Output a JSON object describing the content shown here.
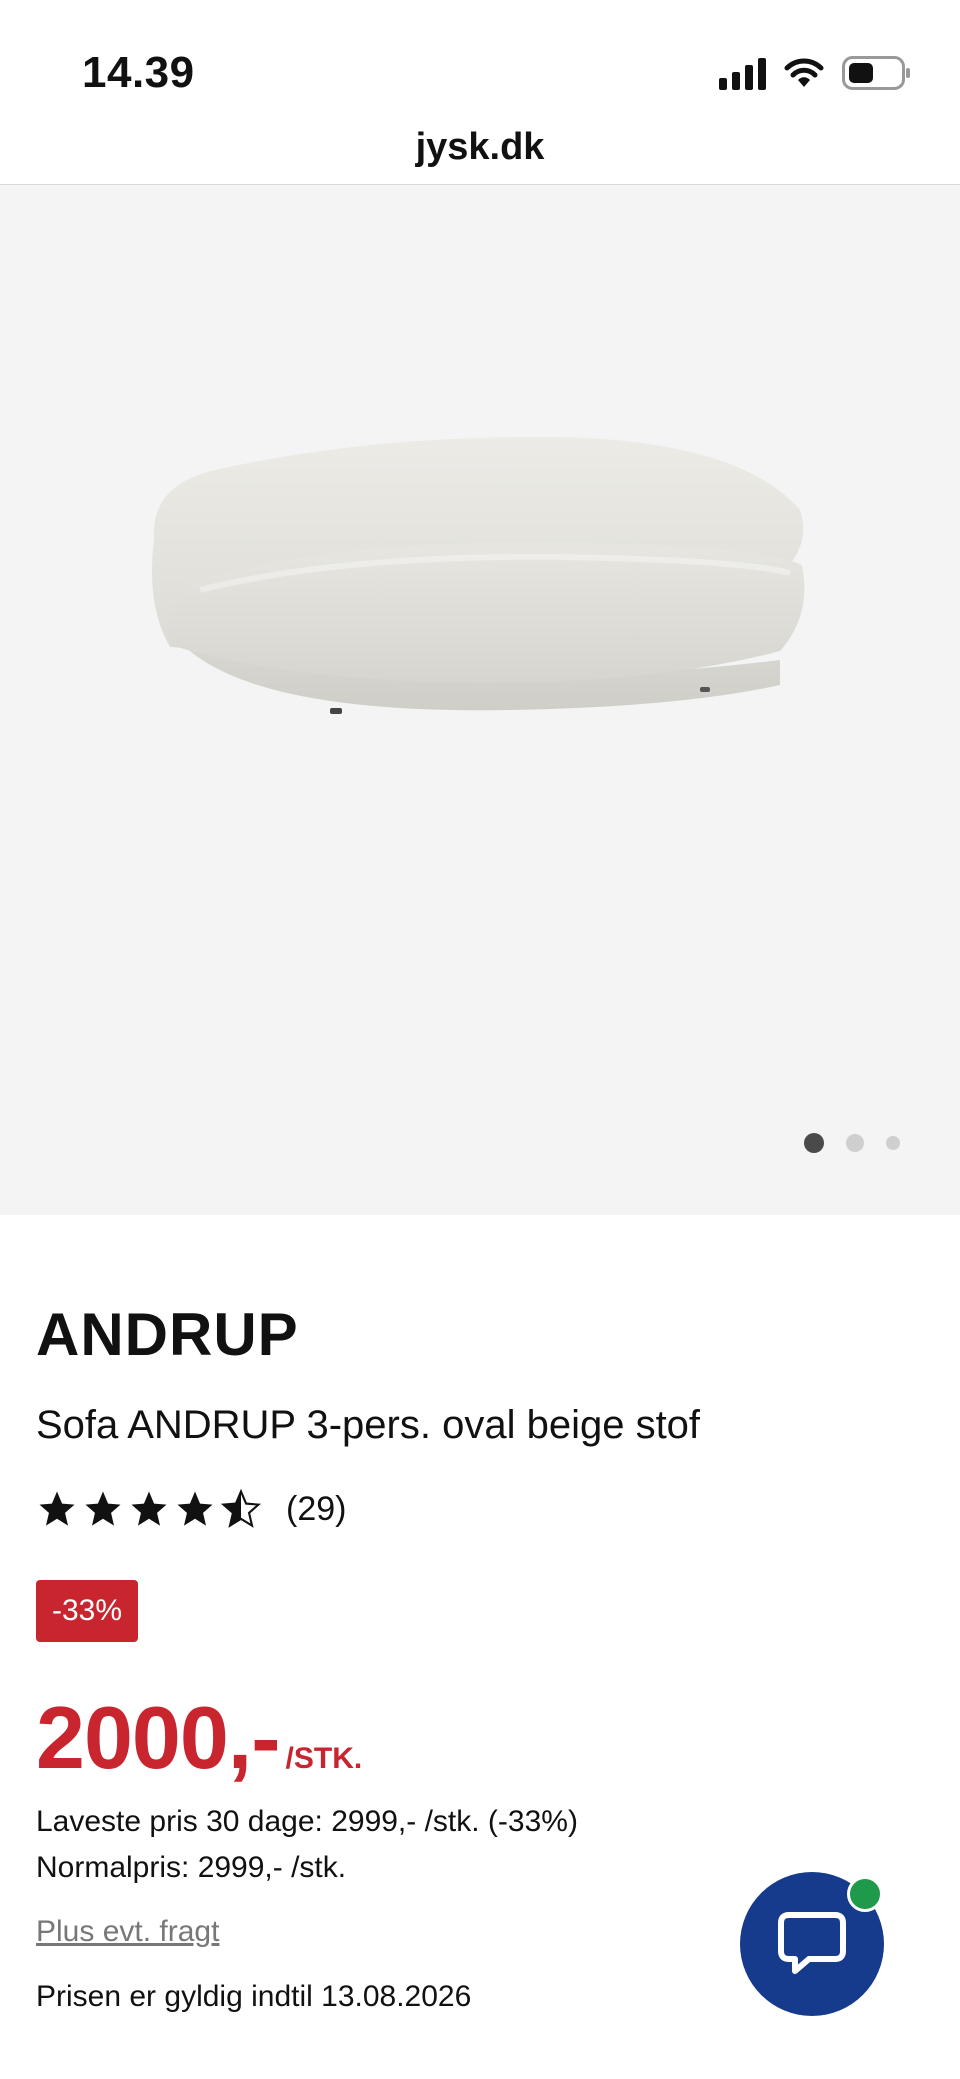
{
  "status_bar": {
    "time": "14.39",
    "icons": [
      "cellular-signal-icon",
      "wifi-icon",
      "battery-icon"
    ]
  },
  "browser": {
    "url": "jysk.dk"
  },
  "gallery": {
    "image": "sofa-product-image",
    "dots": 3,
    "active_index": 0
  },
  "product": {
    "brand": "ANDRUP",
    "title": "Sofa ANDRUP 3-pers. oval beige stof",
    "rating": 4.5,
    "review_count": "(29)",
    "discount_badge": "-33%",
    "price": "2000,-",
    "price_unit": "/STK.",
    "lowest_price": "Laveste pris 30 dage: 2999,- /stk. (-33%)",
    "normal_price": "Normalpris: 2999,- /stk.",
    "freight_link": "Plus evt. fragt",
    "valid_until": "Prisen er gyldig indtil 13.08.2026"
  },
  "chat": {
    "icon": "chat-bubble-icon",
    "online": true
  },
  "colors": {
    "accent_red": "#c8252f",
    "chat_blue": "#163a8c",
    "online_green": "#1f9a4a"
  }
}
